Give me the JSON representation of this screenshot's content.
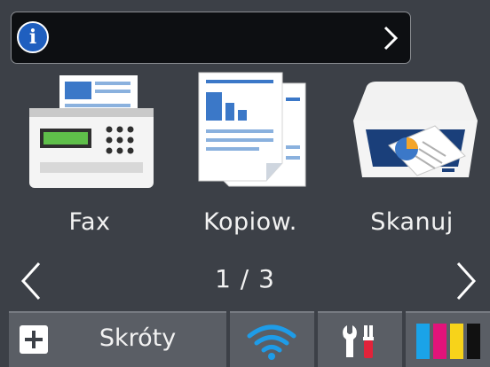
{
  "info_bar": {
    "icon": "info-icon",
    "icon_glyph": "i",
    "chevron": "chevron-right-icon"
  },
  "apps": [
    {
      "label": "Fax",
      "icon": "fax-icon"
    },
    {
      "label": "Kopiow.",
      "icon": "copy-icon"
    },
    {
      "label": "Skanuj",
      "icon": "scanner-icon"
    }
  ],
  "pager": {
    "indicator": "1 / 3",
    "prev_icon": "chevron-left-icon",
    "next_icon": "chevron-right-icon"
  },
  "bottom_bar": {
    "shortcuts_label": "Skróty",
    "shortcuts_icon": "plus-icon",
    "wifi_icon": "wifi-icon",
    "settings_icon": "tools-icon",
    "ink_icon": "ink-levels-icon"
  },
  "colors": {
    "background": "#3c4047",
    "accent_blue": "#1f5fbf",
    "ink_cyan": "#1aa3e8",
    "ink_magenta": "#e2137a",
    "ink_yellow": "#f7d31a",
    "ink_black": "#111111"
  }
}
